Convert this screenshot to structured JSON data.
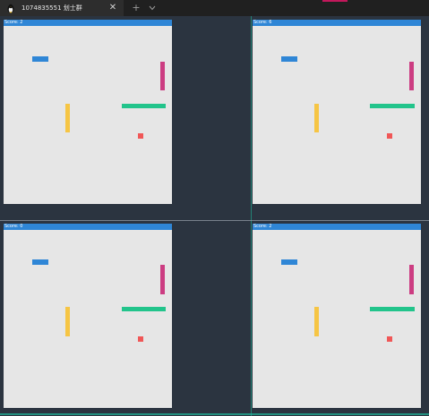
{
  "titlebar": {
    "tab_title": "1074835551 划士群",
    "close_glyph": "✕",
    "new_tab_glyph": "+",
    "tab_icon": "penguin-icon",
    "dropdown_icon": "chevron-down-icon",
    "accent_color": "#c2185b"
  },
  "panes": [
    {
      "score": "Score: 2"
    },
    {
      "score": "Score: 6"
    },
    {
      "score": "Score: 0"
    },
    {
      "score": "Score: 2"
    }
  ],
  "colors": {
    "score_bar": "#2f86d6",
    "board": "#e6e6e6",
    "blue_block": "#2f86d6",
    "magenta_block": "#cc3d82",
    "green_block": "#22c48b",
    "yellow_block": "#f6c544",
    "red_food": "#f05757",
    "divider": "#1fb89a"
  }
}
